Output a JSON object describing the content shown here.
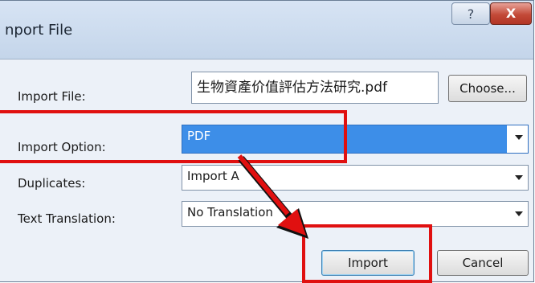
{
  "window": {
    "title": "nport File",
    "help_label": "?",
    "close_label": "X"
  },
  "form": {
    "import_file_label": "Import File:",
    "import_file_value": "生物資產价值評估方法研究.pdf",
    "choose_label": "Choose...",
    "import_option_label": "Import Option:",
    "import_option_value": "PDF",
    "duplicates_label": "Duplicates:",
    "duplicates_value": "Import A",
    "text_translation_label": "Text Translation:",
    "text_translation_value": "No Translation"
  },
  "actions": {
    "import_label": "Import",
    "cancel_label": "Cancel"
  },
  "annotation_color": "#e01010"
}
